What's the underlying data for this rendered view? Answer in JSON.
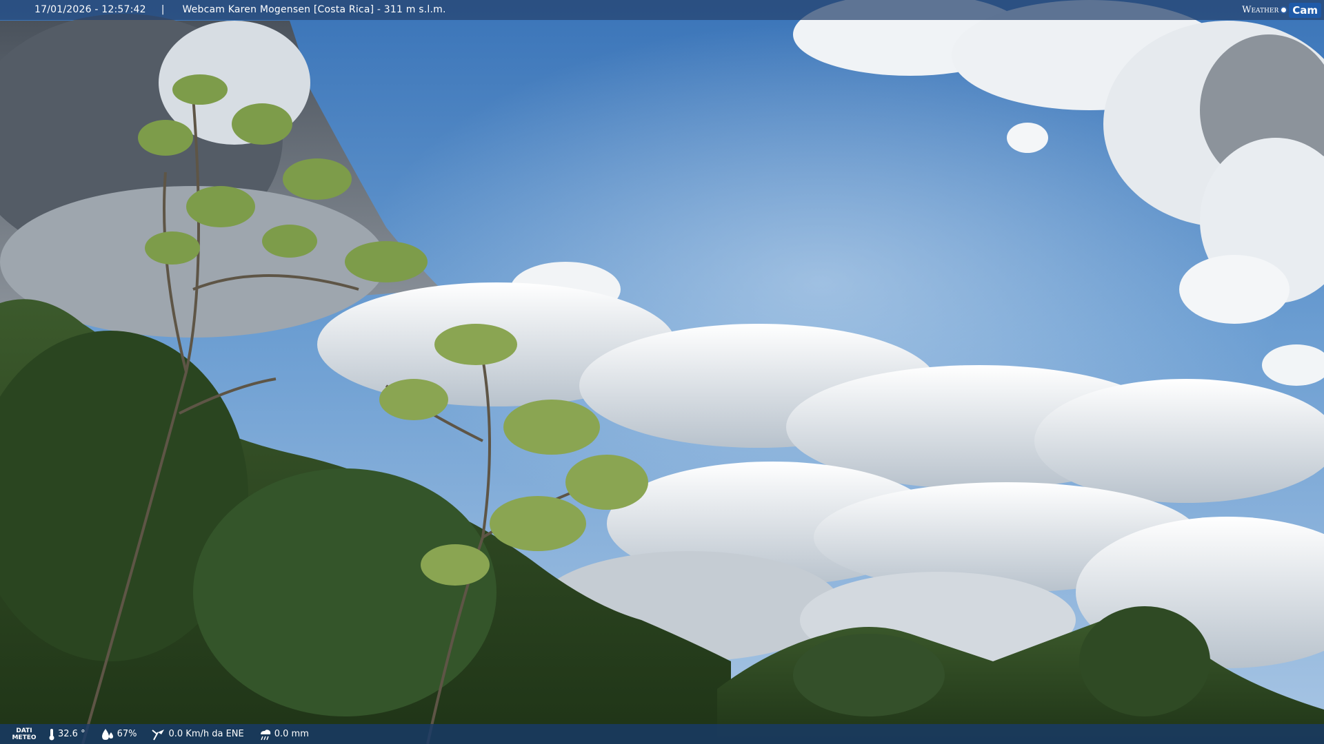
{
  "header": {
    "timestamp": "17/01/2026 - 12:57:42",
    "separator": "|",
    "title": "Webcam Karen Mogensen [Costa Rica] - 311 m s.l.m."
  },
  "brand": {
    "weather": "Weather",
    "cam": "Cam"
  },
  "footer": {
    "label_line1": "DATI",
    "label_line2": "METEO",
    "temperature": "32.6 °",
    "humidity": "67%",
    "wind": "0.0 Km/h da ENE",
    "rain": "0.0 mm"
  },
  "icons": {
    "temperature": "thermometer-icon",
    "humidity": "droplet-icon",
    "wind": "wind-vane-icon",
    "rain": "rain-cloud-icon"
  },
  "colors": {
    "bar": "#26426e",
    "brand_blue": "#1f5aa8"
  }
}
